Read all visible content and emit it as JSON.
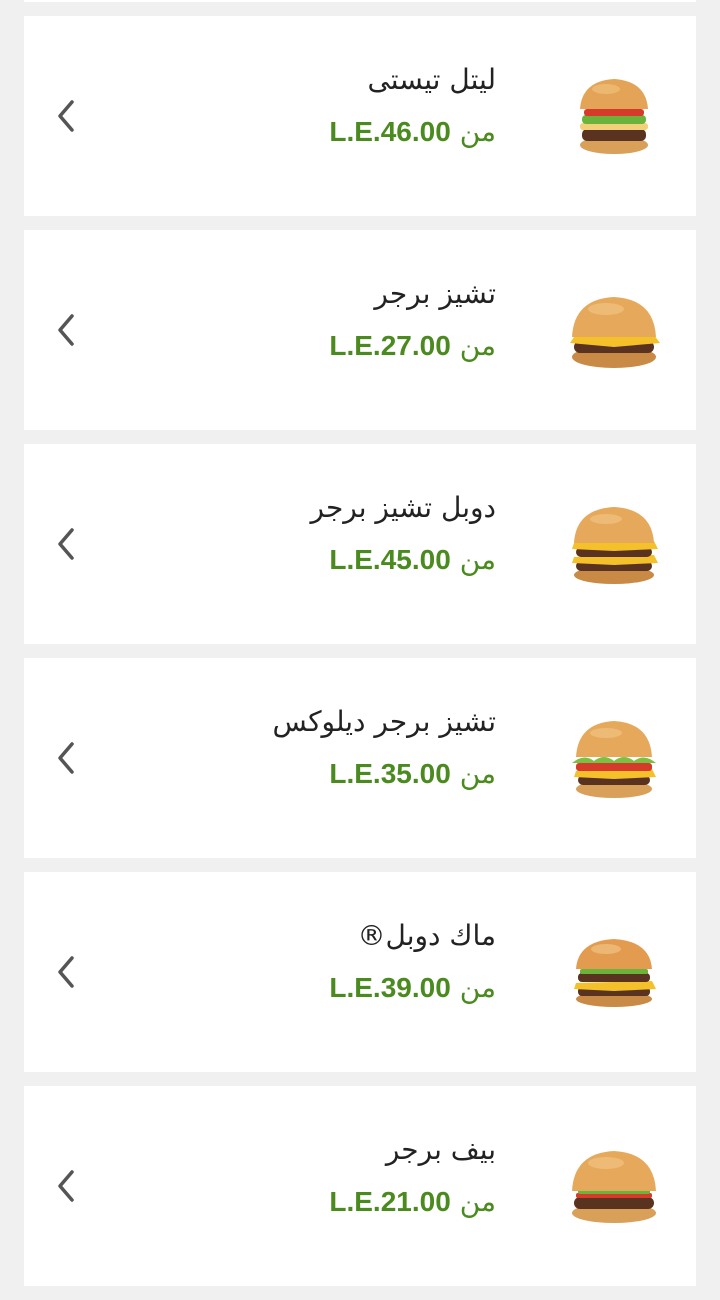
{
  "menu": {
    "price_prefix": "من",
    "items": [
      {
        "name": "ليتل تيستى",
        "price": "L.E.46.00",
        "icon": "burger-image-little-tasty"
      },
      {
        "name": "تشيز برجر",
        "price": "L.E.27.00",
        "icon": "burger-image-cheeseburger"
      },
      {
        "name": "دوبل تشيز برجر",
        "price": "L.E.45.00",
        "icon": "burger-image-double-cheeseburger"
      },
      {
        "name": "تشيز برجر ديلوكس",
        "price": "L.E.35.00",
        "icon": "burger-image-cheeseburger-deluxe"
      },
      {
        "name": "ماك دوبل®",
        "price": "L.E.39.00",
        "icon": "burger-image-mcdouble"
      },
      {
        "name": "بيف برجر",
        "price": "L.E.21.00",
        "icon": "burger-image-beef-burger"
      }
    ]
  },
  "colors": {
    "price": "#4a8a1e",
    "background": "#f0f0f0",
    "card": "#ffffff"
  }
}
